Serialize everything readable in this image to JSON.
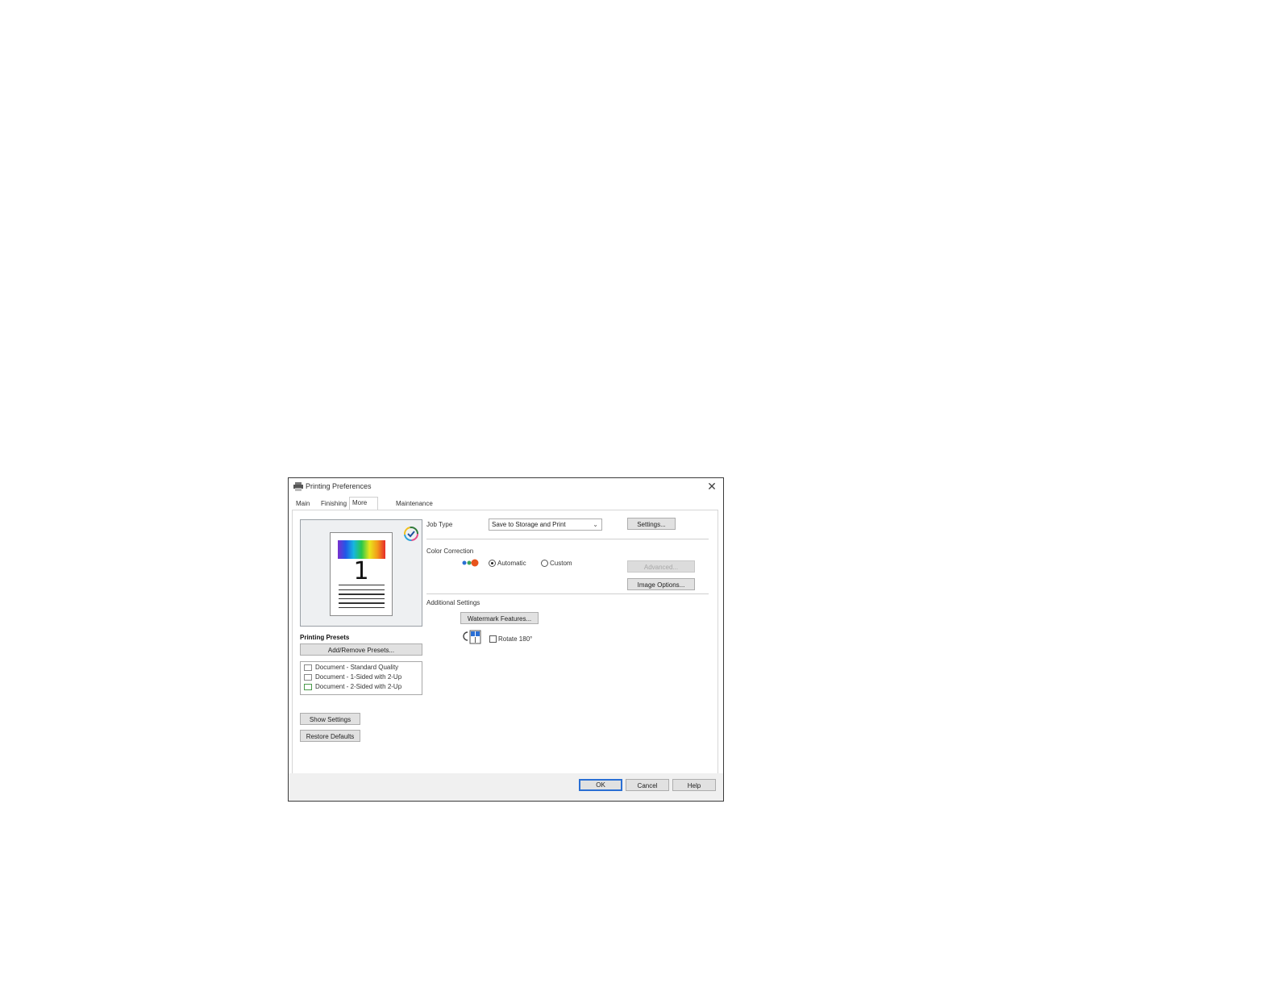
{
  "window": {
    "title": "Printing Preferences",
    "close_glyph": "✕"
  },
  "tabs": [
    {
      "label": "Main",
      "active": false
    },
    {
      "label": "Finishing",
      "active": false
    },
    {
      "label": "More Options",
      "active": true
    },
    {
      "label": "Maintenance",
      "active": false
    }
  ],
  "preview": {
    "page_number": "1"
  },
  "presets": {
    "heading": "Printing Presets",
    "add_remove_label": "Add/Remove Presets...",
    "items": [
      {
        "label": "Document - Standard Quality",
        "icon": "document-icon"
      },
      {
        "label": "Document - 1-Sided with 2-Up",
        "icon": "two-up-icon"
      },
      {
        "label": "Document - 2-Sided with 2-Up",
        "icon": "two-sided-icon"
      }
    ]
  },
  "left_buttons": {
    "show_settings": "Show Settings",
    "restore_defaults": "Restore Defaults"
  },
  "job_type": {
    "label": "Job Type",
    "value": "Save to Storage and Print",
    "settings_label": "Settings..."
  },
  "color_correction": {
    "label": "Color Correction",
    "automatic_label": "Automatic",
    "custom_label": "Custom",
    "selected": "Automatic",
    "advanced_label": "Advanced...",
    "image_options_label": "Image Options..."
  },
  "additional_settings": {
    "label": "Additional Settings",
    "watermark_label": "Watermark Features...",
    "rotate_label": "Rotate 180°",
    "rotate_checked": false
  },
  "footer": {
    "ok_label": "OK",
    "cancel_label": "Cancel",
    "help_label": "Help"
  },
  "colors": {
    "accent": "#2a6fd4",
    "button_face": "#e1e1e1"
  }
}
